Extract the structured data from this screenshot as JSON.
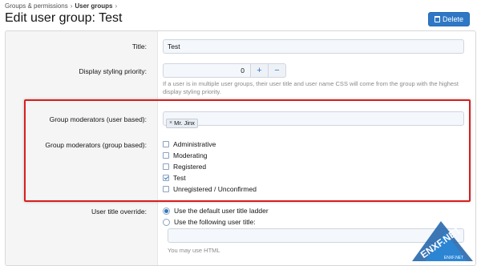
{
  "breadcrumb": {
    "parent": "Groups & permissions",
    "current": "User groups"
  },
  "page_title": "Edit user group: Test",
  "delete_label": "Delete",
  "title_field": {
    "label": "Title:",
    "value": "Test"
  },
  "priority_field": {
    "label": "Display styling priority:",
    "value": "0",
    "plus": "+",
    "minus": "−",
    "hint": "If a user is in multiple user groups, their user title and user name CSS will come from the group with the highest display styling priority."
  },
  "moderators_user": {
    "label": "Group moderators (user based):",
    "token": "Mr. Jinx",
    "token_remove": "×"
  },
  "moderators_group": {
    "label": "Group moderators (group based):",
    "options": [
      {
        "label": "Administrative",
        "checked": false
      },
      {
        "label": "Moderating",
        "checked": false
      },
      {
        "label": "Registered",
        "checked": false
      },
      {
        "label": "Test",
        "checked": true
      },
      {
        "label": "Unregistered / Unconfirmed",
        "checked": false
      }
    ]
  },
  "title_override": {
    "label": "User title override:",
    "option_default": "Use the default user title ladder",
    "option_custom": "Use the following user title:",
    "selected": "default",
    "hint": "You may use HTML"
  },
  "watermark": {
    "text": "ENXF.NET",
    "sub": "ENXF.NET"
  },
  "colors": {
    "accent": "#2f77c5",
    "highlight": "#d81e1e"
  }
}
